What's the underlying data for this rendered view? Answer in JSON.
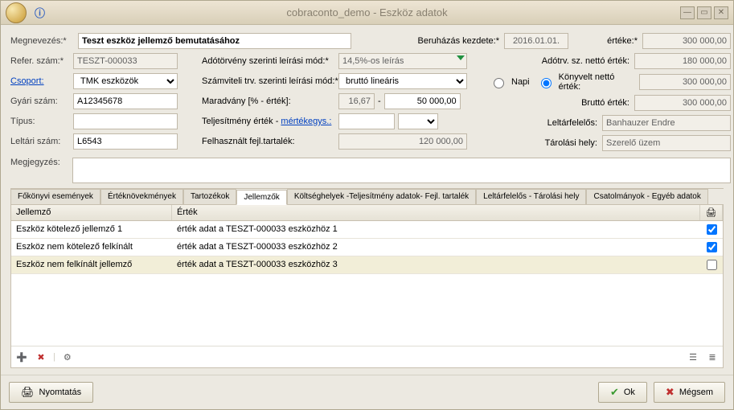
{
  "window": {
    "title": "cobraconto_demo - Eszköz adatok"
  },
  "labels": {
    "megnevezes": "Megnevezés:*",
    "beruhazas_kezdete": "Beruházás kezdete:*",
    "erteke": "értéke:*",
    "refer_szam": "Refer. szám:*",
    "adotorveny": "Adótörvény szerinti leírási mód:*",
    "adotrv_netto": "Adótrv. sz. nettó érték:",
    "csoport": "Csoport:",
    "szamviteli": "Számviteli trv. szerinti leírási mód:*",
    "napi": "Napi",
    "konyvelt_netto": "Könyvelt nettó érték:",
    "gyari_szam": "Gyári szám:",
    "maradvany": "Maradvány [% - érték]:",
    "brutto": "Bruttó érték:",
    "tipus": "Típus:",
    "teljesitmeny": "Teljesítmény érték - ",
    "mertekegys": "mértékegys.:",
    "leltarfelelos": "Leltárfelelős:",
    "leltari_szam": "Leltári szám:",
    "felhasznalt": "Felhasznált fejl.tartalék:",
    "tarolasi": "Tárolási hely:",
    "megjegyzes": "Megjegyzés:"
  },
  "values": {
    "megnevezes": "Teszt eszköz jellemző bemutatásához",
    "beruhazas_kezdete": "2016.01.01.",
    "erteke": "300 000,00",
    "refer_szam": "TESZT-000033",
    "adotorveny": "14,5%-os leírás",
    "adotrv_netto": "180 000,00",
    "csoport": "TMK eszközök",
    "szamviteli": "bruttó lineáris",
    "konyvelt_netto": "300 000,00",
    "gyari_szam": "A12345678",
    "maradvany_pct": "16,67",
    "maradvany_val": "50 000,00",
    "brutto": "300 000,00",
    "tipus": "",
    "teljesitmeny": "",
    "leltarfelelos": "Banhauzer Endre",
    "leltari_szam": "L6543",
    "felhasznalt": "120 000,00",
    "tarolasi": "Szerelő üzem",
    "megjegyzes": ""
  },
  "tabs": [
    "Főkönyvi események",
    "Értéknövekmények",
    "Tartozékok",
    "Jellemzők",
    "Költséghelyek -Teljesítmény adatok- Fejl. tartalék",
    "Leltárfelelős - Tárolási hely",
    "Csatolmányok - Egyéb adatok"
  ],
  "grid": {
    "headers": {
      "attr": "Jellemző",
      "val": "Érték"
    },
    "rows": [
      {
        "attr": "Eszköz kötelező jellemző 1",
        "val": "érték adat a TESZT-000033 eszközhöz 1",
        "checked": true
      },
      {
        "attr": "Eszköz nem kötelező felkínált",
        "val": "érték adat a TESZT-000033 eszközhöz 2",
        "checked": true
      },
      {
        "attr": "Eszköz nem felkínált jellemző",
        "val": "érték adat a TESZT-000033 eszközhöz 3",
        "checked": false
      }
    ]
  },
  "buttons": {
    "print": "Nyomtatás",
    "ok": "Ok",
    "cancel": "Mégsem"
  }
}
